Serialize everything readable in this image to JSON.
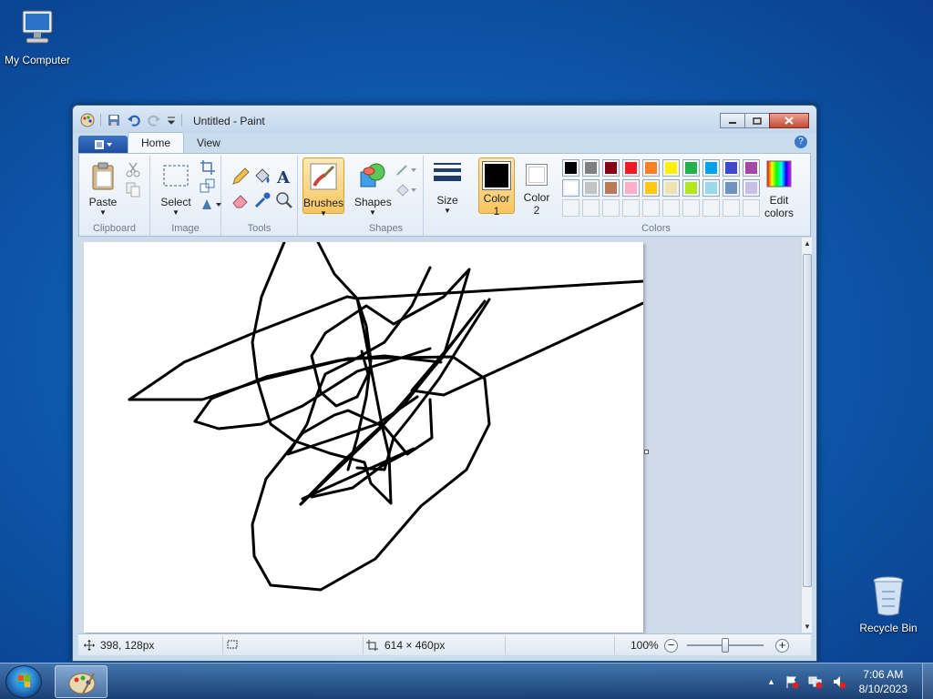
{
  "desktop": {
    "my_computer": "My Computer",
    "recycle_bin": "Recycle Bin"
  },
  "window": {
    "title": "Untitled - Paint",
    "tabs": [
      "Home",
      "View"
    ],
    "groups": {
      "clipboard": "Clipboard",
      "image": "Image",
      "tools": "Tools",
      "shapes": "Shapes",
      "colors": "Colors"
    },
    "buttons": {
      "paste": "Paste",
      "select": "Select",
      "brushes": "Brushes",
      "shapes": "Shapes",
      "size": "Size",
      "color1_a": "Color",
      "color1_b": "1",
      "color2_a": "Color",
      "color2_b": "2",
      "edit_colors_a": "Edit",
      "edit_colors_b": "colors"
    },
    "palette_row1": [
      "#000000",
      "#7f7f7f",
      "#880015",
      "#ed1c24",
      "#ff7f27",
      "#fff200",
      "#22b14c",
      "#00a2e8",
      "#3f48cc",
      "#a349a4"
    ],
    "palette_row2": [
      "#ffffff",
      "#c3c3c3",
      "#b97a57",
      "#ffaec9",
      "#ffc90e",
      "#efe4b0",
      "#b5e61d",
      "#99d9ea",
      "#7092be",
      "#c8bfe7"
    ],
    "color1": "#000000",
    "color2": "#ffffff"
  },
  "status": {
    "cursor_pos": "398, 128px",
    "canvas_size": "614 × 460px",
    "zoom": "100%"
  },
  "taskbar": {
    "time": "7:06 AM",
    "date": "8/10/2023"
  }
}
